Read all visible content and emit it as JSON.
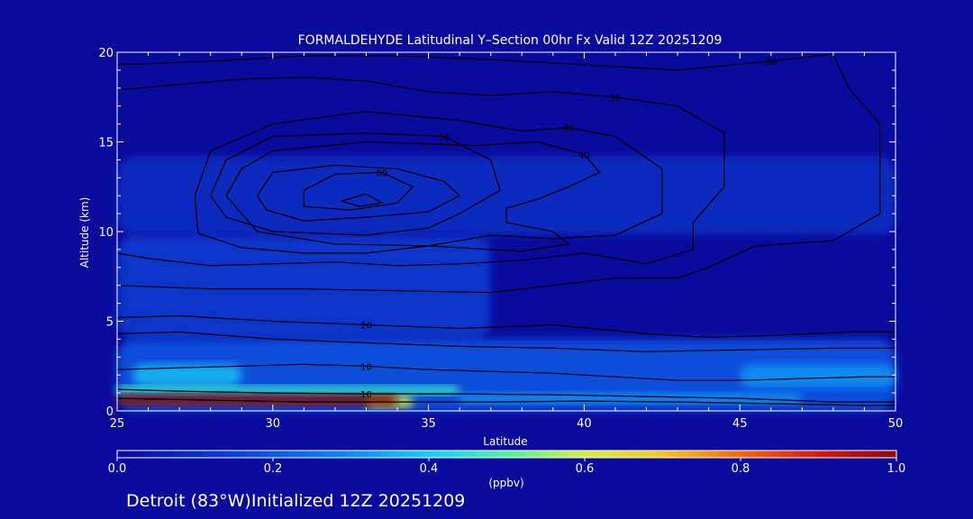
{
  "chart_data": {
    "type": "heatmap",
    "title": "FORMALDEHYDE Latitudinal Y–Section 00hr  Fx Valid 12Z 20251209",
    "xlabel": "Latitude",
    "ylabel": "Altitude (km)",
    "xlim": [
      25,
      50
    ],
    "ylim": [
      0,
      20
    ],
    "x_ticks": [
      25,
      30,
      35,
      40,
      45,
      50
    ],
    "y_ticks": [
      0,
      5,
      10,
      15,
      20
    ],
    "colorbar": {
      "label": "(ppbv)",
      "range": [
        0.0,
        1.0
      ],
      "ticks": [
        "0.0",
        "0.2",
        "0.4",
        "0.6",
        "0.8",
        "1.0"
      ]
    },
    "footer": "Detroit (83°W)Initialized 12Z 20251209",
    "fill": [
      {
        "lat": [
          25,
          34
        ],
        "alt": [
          0.3,
          0.9
        ],
        "value": 1.0
      },
      {
        "lat": [
          33,
          34.5
        ],
        "alt": [
          0.2,
          0.8
        ],
        "value": 0.6
      },
      {
        "lat": [
          25,
          36
        ],
        "alt": [
          0.9,
          1.4
        ],
        "value": 0.45
      },
      {
        "lat": [
          25.5,
          29
        ],
        "alt": [
          1.4,
          2.6
        ],
        "value": 0.35
      },
      {
        "lat": [
          36,
          47
        ],
        "alt": [
          0.4,
          1.0
        ],
        "value": 0.3
      },
      {
        "lat": [
          45,
          50
        ],
        "alt": [
          1.3,
          2.6
        ],
        "value": 0.3
      },
      {
        "lat": [
          25,
          50
        ],
        "alt": [
          0,
          4
        ],
        "value": 0.18
      },
      {
        "lat": [
          25,
          37
        ],
        "alt": [
          4,
          9.8
        ],
        "value": 0.12
      },
      {
        "lat": [
          25,
          50
        ],
        "alt": [
          9.8,
          14.2
        ],
        "value": 0.09
      }
    ],
    "contours": [
      {
        "label": "40",
        "x": [
          28.5,
          29,
          30,
          33,
          36.5,
          38.5,
          40,
          40.5,
          39.5,
          38.5,
          37.5,
          37.5,
          39,
          39.5,
          38,
          35,
          32,
          29.5,
          28.5
        ],
        "y": [
          12,
          13.5,
          14.5,
          15,
          14.8,
          15,
          14.3,
          13.3,
          12.5,
          11.8,
          11.3,
          10.5,
          10,
          9.3,
          8.9,
          9.2,
          9.3,
          10,
          12
        ]
      },
      {
        "label": "",
        "x": [
          29.5,
          30,
          32,
          34,
          35.5,
          36,
          35,
          33,
          31,
          29.8,
          29.5
        ],
        "y": [
          12,
          13.3,
          13.7,
          13.5,
          12.8,
          12,
          11.1,
          10.8,
          10.6,
          11.2,
          12
        ]
      },
      {
        "label": "60",
        "x": [
          31,
          32,
          33.5,
          34.5,
          34,
          32.5,
          31,
          31
        ],
        "y": [
          12.3,
          13.2,
          13.3,
          12.5,
          11.6,
          11.2,
          11.4,
          12.3
        ]
      },
      {
        "label": "",
        "x": [
          32.2,
          33,
          33.5,
          32.8,
          32.2
        ],
        "y": [
          11.7,
          12.1,
          11.6,
          11.4,
          11.7
        ]
      },
      {
        "label": "50",
        "x": [
          28,
          28.5,
          30,
          33,
          35.5,
          37,
          37.3,
          36,
          35,
          33,
          30,
          28.5,
          28
        ],
        "y": [
          12,
          14,
          15.3,
          15.5,
          15.3,
          14,
          12.3,
          11,
          10.2,
          9.8,
          10,
          10.8,
          12
        ]
      },
      {
        "label": "40",
        "x": [
          27.5,
          28,
          30,
          33,
          36,
          38,
          39.5,
          41,
          42.5,
          42.5,
          41,
          39,
          37,
          35,
          33,
          31,
          29,
          27.6,
          27.5
        ],
        "y": [
          12,
          14.5,
          16,
          16.7,
          16.2,
          15.6,
          15.8,
          15.3,
          13.5,
          11,
          9.8,
          9.6,
          9.8,
          9.2,
          8.8,
          8.8,
          9.1,
          9.9,
          12
        ]
      },
      {
        "label": "30",
        "x": [
          25,
          27,
          29,
          31,
          33,
          35,
          37,
          39,
          41,
          43,
          44.5,
          44.5,
          43.5,
          43.5,
          42,
          40,
          38,
          36,
          34,
          32,
          30,
          28,
          26,
          25
        ],
        "y": [
          17.9,
          18.2,
          18.5,
          18.6,
          18.4,
          17.8,
          17.6,
          17.8,
          17.5,
          17,
          15.5,
          12.5,
          10.5,
          9,
          8.2,
          8.8,
          8.4,
          8.2,
          8.1,
          8.3,
          8.2,
          8.1,
          8.5,
          8.8
        ]
      },
      {
        "label": "20",
        "x": [
          25,
          28,
          31,
          34,
          37,
          40,
          43,
          46,
          48,
          48.5,
          49.5,
          49.5,
          48,
          45.5,
          44,
          43,
          41,
          39,
          37,
          34,
          31,
          28,
          25
        ],
        "y": [
          19.3,
          19.5,
          19.8,
          19.8,
          19.6,
          19.3,
          19,
          19.5,
          19.9,
          18,
          16,
          11,
          9.5,
          9.2,
          8,
          7.4,
          7.4,
          7,
          6.6,
          6.7,
          6.8,
          6.8,
          7
        ]
      },
      {
        "label": "20",
        "x": [
          25,
          27,
          30,
          33,
          36,
          39,
          42,
          44,
          46,
          48.5,
          50
        ],
        "y": [
          5.2,
          5.3,
          5.0,
          4.8,
          4.6,
          4.8,
          4.3,
          4.1,
          4.2,
          4.4,
          4.4
        ]
      },
      {
        "label": "",
        "x": [
          25,
          27,
          30,
          33,
          36,
          39,
          42,
          45,
          48,
          50
        ],
        "y": [
          4.3,
          4.4,
          4.0,
          3.8,
          3.6,
          3.5,
          3.3,
          3.4,
          3.5,
          3.5
        ]
      },
      {
        "label": "10",
        "x": [
          25,
          27,
          29,
          31,
          33,
          35,
          37,
          39,
          41,
          43,
          45,
          47,
          49,
          50
        ],
        "y": [
          2.3,
          2.4,
          2.5,
          2.6,
          2.5,
          2.3,
          2.2,
          2.1,
          1.9,
          1.7,
          1.7,
          1.8,
          1.9,
          1.9
        ]
      },
      {
        "label": "10",
        "x": [
          25,
          27,
          30,
          33,
          36,
          39,
          42,
          45,
          48,
          50
        ],
        "y": [
          1.2,
          1.1,
          1.0,
          0.95,
          0.95,
          0.9,
          0.8,
          0.7,
          0.5,
          0.5
        ]
      },
      {
        "label": "",
        "x": [
          25,
          28,
          31,
          34,
          37,
          40,
          43,
          46,
          49,
          50
        ],
        "y": [
          0.7,
          0.6,
          0.5,
          0.5,
          0.5,
          0.55,
          0.5,
          0.4,
          0.3,
          0.3
        ]
      }
    ]
  }
}
